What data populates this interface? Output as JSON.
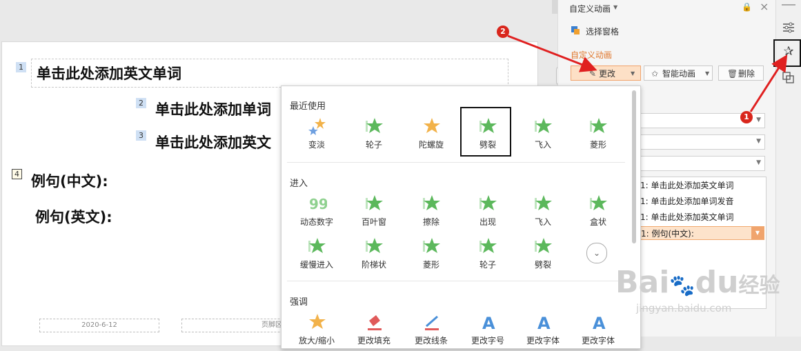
{
  "slide": {
    "items": [
      {
        "num": "1",
        "text": "单击此处添加英文单词"
      },
      {
        "num": "2",
        "text": "单击此处添加单词"
      },
      {
        "num": "3",
        "text": "单击此处添加英文"
      },
      {
        "num": "4",
        "text": "例句(中文):"
      },
      {
        "num": "",
        "text": "例句(英文):"
      }
    ],
    "footer_date": "2020-6-12",
    "footer_text": "页脚区"
  },
  "pane": {
    "title": "自定义动画",
    "title_dropdown_icon": "caret-down-icon",
    "selection_pane": "选择窗格",
    "section_label": "自定义动画",
    "change_button": "更改",
    "smart_animation_button": "智能动画",
    "delete_button": "删除",
    "list_items": [
      "1: 单击此处添加英文单词",
      "1: 单击此处添加单词发音",
      "1: 单击此处添加英文单词",
      "1: 例句(中文):"
    ],
    "accent_color": "#e0772c"
  },
  "gallery": {
    "recent_label": "最近使用",
    "recent": [
      "变淡",
      "轮子",
      "陀螺旋",
      "劈裂",
      "飞入",
      "菱形"
    ],
    "entrance_label": "进入",
    "entrance_row1": [
      "动态数字",
      "百叶窗",
      "擦除",
      "出现",
      "飞入",
      "盒状"
    ],
    "entrance_row2": [
      "缓慢进入",
      "阶梯状",
      "菱形",
      "轮子",
      "劈裂"
    ],
    "emphasis_label": "强调",
    "emphasis": [
      "放大/缩小",
      "更改填充",
      "更改线条",
      "更改字号",
      "更改字体",
      "更改字体"
    ],
    "more_icon": "chevron-down-icon",
    "star_color": "#5cb85c"
  },
  "annotations": {
    "badge1": "1",
    "badge2": "2"
  },
  "watermark": {
    "brand": "Bai",
    "brand_suffix": "du",
    "brand_cn": "经验",
    "url": "jingyan.baidu.com"
  }
}
